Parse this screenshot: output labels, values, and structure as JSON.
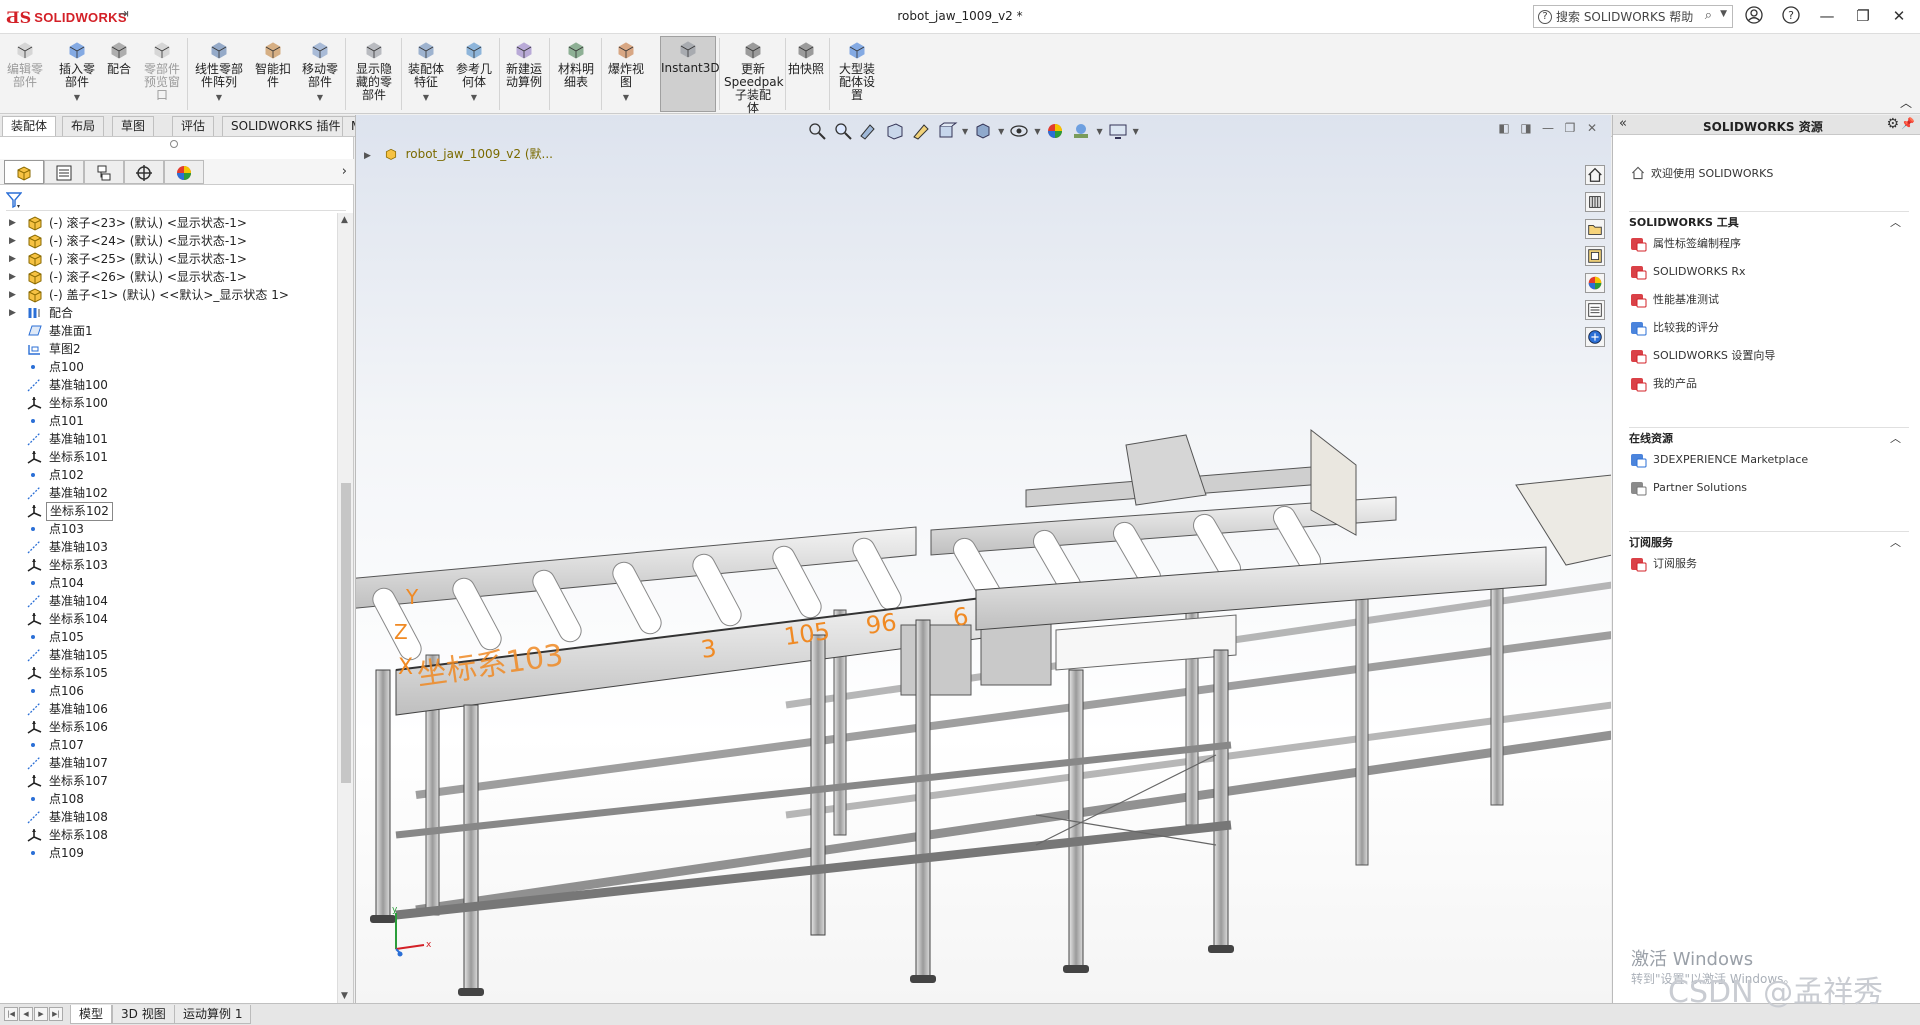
{
  "titlebar": {
    "brand": "SOLIDWORKS",
    "document": "robot_jaw_1009_v2 *",
    "search_placeholder": "搜索 SOLIDWORKS 帮助"
  },
  "ribbon": {
    "buttons": [
      {
        "label": "编辑零\n部件",
        "disabled": true
      },
      {
        "label": "插入零\n部件"
      },
      {
        "label": "配合"
      },
      {
        "label": "零部件\n预览窗\n口",
        "disabled": true
      },
      {
        "label": "线性零部\n件阵列"
      },
      {
        "label": "智能扣\n件"
      },
      {
        "label": "移动零\n部件"
      },
      {
        "label": "显示隐\n藏的零\n部件"
      },
      {
        "label": "装配体\n特征"
      },
      {
        "label": "参考几\n何体"
      },
      {
        "label": "新建运\n动算例"
      },
      {
        "label": "材料明\n细表"
      },
      {
        "label": "爆炸视\n图"
      },
      {
        "label": "Instant3D"
      },
      {
        "label": "更新\nSpeedpak\n子装配\n体"
      },
      {
        "label": "拍快照"
      },
      {
        "label": "大型装\n配体设\n置"
      }
    ]
  },
  "tabs": [
    "装配体",
    "布局",
    "草图",
    "评估",
    "SOLIDWORKS 插件",
    "MBD"
  ],
  "tree": {
    "rows": [
      {
        "label": "(-) 滚子<23> (默认) <显示状态-1>",
        "type": "part",
        "exp": true
      },
      {
        "label": "(-) 滚子<24> (默认) <显示状态-1>",
        "type": "part",
        "exp": true
      },
      {
        "label": "(-) 滚子<25> (默认) <显示状态-1>",
        "type": "part",
        "exp": true
      },
      {
        "label": "(-) 滚子<26> (默认) <显示状态-1>",
        "type": "part",
        "exp": true
      },
      {
        "label": "(-) 盖子<1> (默认) <<默认>_显示状态 1>",
        "type": "part",
        "exp": true
      },
      {
        "label": "配合",
        "type": "mate",
        "exp": true
      },
      {
        "label": "基准面1",
        "type": "plane"
      },
      {
        "label": "草图2",
        "type": "sketch"
      },
      {
        "label": "点100",
        "type": "point"
      },
      {
        "label": "基准轴100",
        "type": "axis"
      },
      {
        "label": "坐标系100",
        "type": "csys"
      },
      {
        "label": "点101",
        "type": "point"
      },
      {
        "label": "基准轴101",
        "type": "axis"
      },
      {
        "label": "坐标系101",
        "type": "csys"
      },
      {
        "label": "点102",
        "type": "point"
      },
      {
        "label": "基准轴102",
        "type": "axis"
      },
      {
        "label": "坐标系102",
        "type": "csys",
        "selected": true
      },
      {
        "label": "点103",
        "type": "point"
      },
      {
        "label": "基准轴103",
        "type": "axis"
      },
      {
        "label": "坐标系103",
        "type": "csys"
      },
      {
        "label": "点104",
        "type": "point"
      },
      {
        "label": "基准轴104",
        "type": "axis"
      },
      {
        "label": "坐标系104",
        "type": "csys"
      },
      {
        "label": "点105",
        "type": "point"
      },
      {
        "label": "基准轴105",
        "type": "axis"
      },
      {
        "label": "坐标系105",
        "type": "csys"
      },
      {
        "label": "点106",
        "type": "point"
      },
      {
        "label": "基准轴106",
        "type": "axis"
      },
      {
        "label": "坐标系106",
        "type": "csys"
      },
      {
        "label": "点107",
        "type": "point"
      },
      {
        "label": "基准轴107",
        "type": "axis"
      },
      {
        "label": "坐标系107",
        "type": "csys"
      },
      {
        "label": "点108",
        "type": "point"
      },
      {
        "label": "基准轴108",
        "type": "axis"
      },
      {
        "label": "坐标系108",
        "type": "csys"
      },
      {
        "label": "点109",
        "type": "point"
      }
    ]
  },
  "bottom_tabs": [
    "模型",
    "3D 视图",
    "运动算例 1"
  ],
  "viewport": {
    "tree_root": "robot_jaw_1009_v2 (默...",
    "annotations": {
      "csys": "坐标系103",
      "n3": "3",
      "n105": "105",
      "n96": "96",
      "n6": "6",
      "y": "Y",
      "z": "Z",
      "x": "X"
    },
    "watermark_title": "激活 Windows",
    "watermark_sub": "转到\"设置\"以激活 Windows。",
    "csdn": "CSDN @孟祥秀"
  },
  "resources": {
    "title": "SOLIDWORKS 资源",
    "welcome": "欢迎使用 SOLIDWORKS",
    "sections": [
      {
        "title": "SOLIDWORKS 工具",
        "items": [
          "属性标签编制程序",
          "SOLIDWORKS Rx",
          "性能基准测试",
          "比较我的评分",
          "SOLIDWORKS 设置向导",
          "我的产品"
        ]
      },
      {
        "title": "在线资源",
        "items": [
          "3DEXPERIENCE Marketplace",
          "Partner Solutions"
        ]
      },
      {
        "title": "订阅服务",
        "items": [
          "订阅服务"
        ]
      }
    ]
  },
  "colors": {
    "accent": "#d32027",
    "annotation": "#f08a24"
  }
}
